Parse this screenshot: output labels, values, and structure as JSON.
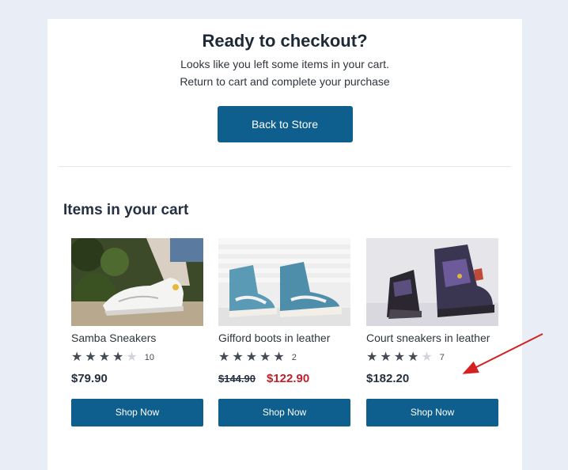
{
  "header": {
    "title": "Ready to checkout?",
    "subtitle_line1": "Looks like you left some items in your cart.",
    "subtitle_line2": "Return to cart and complete your purchase",
    "cta_label": "Back to Store"
  },
  "cart": {
    "title": "Items in your cart",
    "items": [
      {
        "name": "Samba Sneakers",
        "rating": 4,
        "rating_max": 5,
        "review_count": "10",
        "price": "$79.90",
        "button_label": "Shop Now",
        "image_icon": "white-sneaker-photo"
      },
      {
        "name": "Gifford boots in leather",
        "rating": 5,
        "rating_max": 5,
        "review_count": "2",
        "original_price": "$144.90",
        "sale_price": "$122.90",
        "button_label": "Shop Now",
        "image_icon": "blue-hightop-sneaker-photo"
      },
      {
        "name": "Court sneakers in leather",
        "rating": 4,
        "rating_max": 5,
        "review_count": "7",
        "price": "$182.20",
        "button_label": "Shop Now",
        "image_icon": "purple-basketball-shoe-photo"
      }
    ]
  },
  "colors": {
    "page_background": "#e9edf5",
    "primary_button": "#0f5f8e",
    "sale_price": "#c0202a",
    "annotation_arrow": "#d42020"
  }
}
